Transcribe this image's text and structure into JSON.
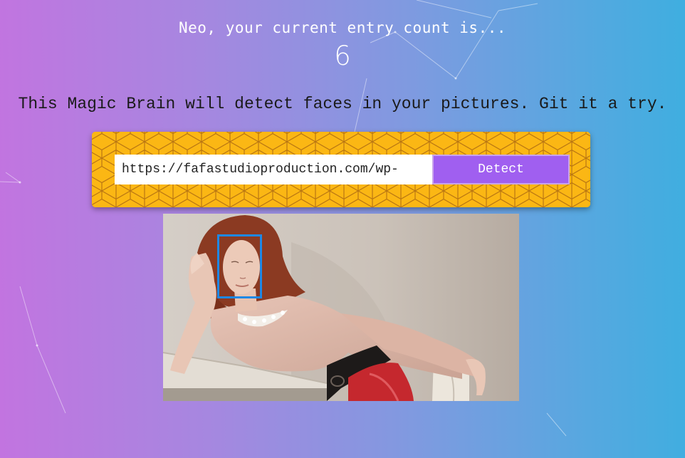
{
  "header": {
    "rank_message": "Neo, your current entry count is...",
    "entry_count": "6"
  },
  "intro_text": "This Magic Brain will detect faces in your pictures. Git it a try.",
  "form": {
    "url_value": "https://fafastudioproduction.com/wp-",
    "detect_label": "Detect"
  },
  "result": {
    "faces_detected": 1
  },
  "colors": {
    "panel": "#fbb714",
    "button": "#a05ff0",
    "face_box": "#1e88e5"
  }
}
